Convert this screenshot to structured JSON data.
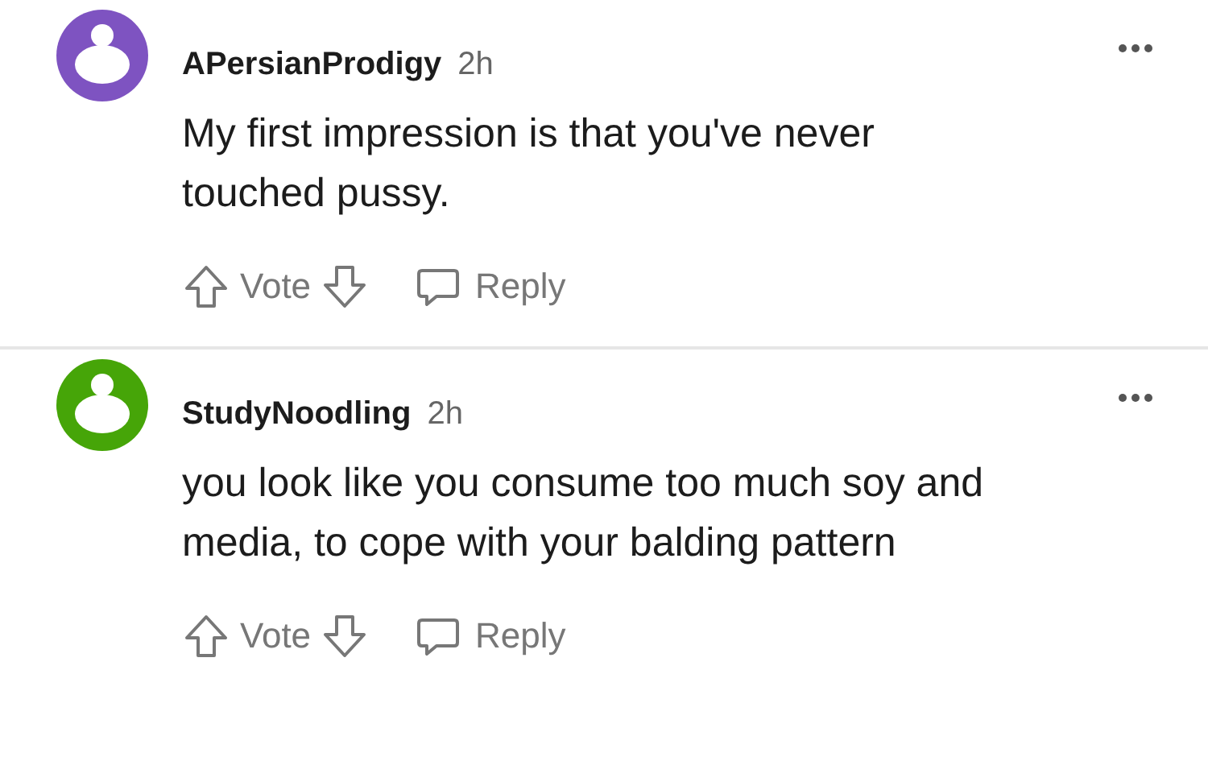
{
  "comments": [
    {
      "author": "APersianProdigy",
      "time": "2h",
      "body": "My first impression is that you've never touched pussy.",
      "color": "#7e53c1",
      "vote_label": "Vote",
      "reply_label": "Reply"
    },
    {
      "author": "StudyNoodling",
      "time": "2h",
      "body": "you look like you consume too much soy and media, to cope with your balding pattern",
      "color": "#46a508",
      "vote_label": "Vote",
      "reply_label": "Reply"
    }
  ]
}
